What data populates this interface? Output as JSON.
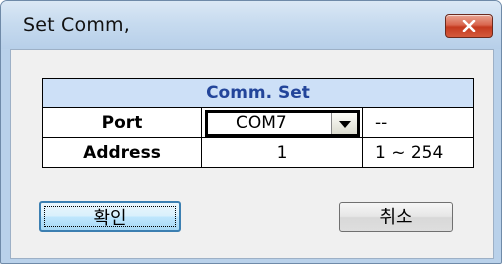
{
  "window": {
    "title": "Set Comm,"
  },
  "table": {
    "header": "Comm. Set",
    "rows": [
      {
        "label": "Port",
        "value": "COM7",
        "range": "--"
      },
      {
        "label": "Address",
        "value": "1",
        "range": "1 ~ 254"
      }
    ]
  },
  "buttons": {
    "ok_label": "확인",
    "cancel_label": "취소"
  },
  "colors": {
    "header_text": "#23459a",
    "header_bg": "#cde0f7",
    "close_button": "#c43a1f"
  }
}
